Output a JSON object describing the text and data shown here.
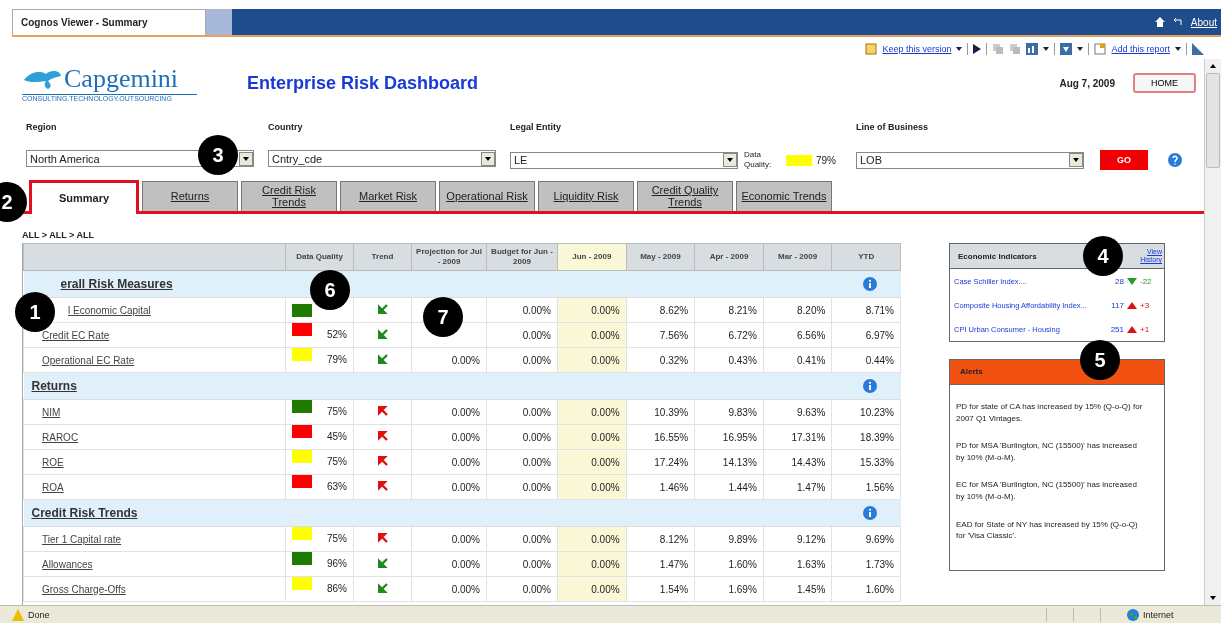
{
  "window": {
    "title": "Cognos Viewer - Summary",
    "about": "About"
  },
  "toolbar": {
    "keep": "Keep this version",
    "add": "Add this report"
  },
  "header": {
    "logo": "Capgemini",
    "tagline": "CONSULTING.TECHNOLOGY.OUTSOURCING",
    "title": "Enterprise Risk Dashboard",
    "date": "Aug 7, 2009",
    "home": "HOME"
  },
  "filters": [
    {
      "label": "Region",
      "value": "North America"
    },
    {
      "label": "Country",
      "value": "Cntry_cde"
    },
    {
      "label": "Legal Entity",
      "value": "LE"
    },
    {
      "label": "Line of Business",
      "value": "LOB"
    }
  ],
  "data_quality": {
    "label": "Data Quality:",
    "color": "#ffff00",
    "value": "79%"
  },
  "go": "GO",
  "tabs": [
    {
      "label": "Summary",
      "selected": true
    },
    {
      "label": "Returns",
      "selected": false
    },
    {
      "label": "Credit Risk Trends",
      "selected": false
    },
    {
      "label": "Market Risk",
      "selected": false
    },
    {
      "label": "Operational Risk",
      "selected": false
    },
    {
      "label": "Liquidity Risk",
      "selected": false
    },
    {
      "label": "Credit Quality Trends",
      "selected": false
    },
    {
      "label": "Economic Trends",
      "selected": false
    }
  ],
  "breadcrumb": "ALL > ALL > ALL",
  "table": {
    "columns": [
      "Data Quality",
      "Trend",
      "Projection for Jul - 2009",
      "Budget for Jun - 2009",
      "Jun - 2009",
      "May - 2009",
      "Apr - 2009",
      "Mar - 2009",
      "YTD"
    ],
    "groups": [
      {
        "title": "erall Risk Measures",
        "rows": [
          {
            "name": "l Economic Capital",
            "color": "#1e7a00",
            "improving": true,
            "values": [
              "0.00%",
              "0.00%",
              "8.62%",
              "8.21%",
              "8.20%",
              "8.71%"
            ]
          },
          {
            "name": "Credit EC Rate",
            "color": "#ff0000",
            "quality": "52%",
            "improving": true,
            "values": [
              "0.00%",
              "0.00%",
              "7.56%",
              "6.72%",
              "6.56%",
              "6.97%"
            ]
          },
          {
            "name": "Operational EC Rate",
            "color": "#ffff00",
            "quality": "79%",
            "improving": true,
            "projection": "0.00%",
            "values": [
              "0.00%",
              "0.00%",
              "0.32%",
              "0.43%",
              "0.41%",
              "0.44%"
            ]
          }
        ]
      },
      {
        "title": "Returns",
        "rows": [
          {
            "name": "NIM",
            "color": "#1e7a00",
            "quality": "75%",
            "improving": false,
            "projection": "0.00%",
            "values": [
              "0.00%",
              "0.00%",
              "10.39%",
              "9.83%",
              "9.63%",
              "10.23%"
            ]
          },
          {
            "name": "RAROC",
            "color": "#ff0000",
            "quality": "45%",
            "improving": false,
            "projection": "0.00%",
            "values": [
              "0.00%",
              "0.00%",
              "16.55%",
              "16.95%",
              "17.31%",
              "18.39%"
            ]
          },
          {
            "name": "ROE",
            "color": "#ffff00",
            "quality": "75%",
            "improving": false,
            "projection": "0.00%",
            "values": [
              "0.00%",
              "0.00%",
              "17.24%",
              "14.13%",
              "14.43%",
              "15.33%"
            ]
          },
          {
            "name": "ROA",
            "color": "#ff0000",
            "quality": "63%",
            "improving": false,
            "projection": "0.00%",
            "values": [
              "0.00%",
              "0.00%",
              "1.46%",
              "1.44%",
              "1.47%",
              "1.56%"
            ]
          }
        ]
      },
      {
        "title": "Credit Risk Trends",
        "rows": [
          {
            "name": "Tier 1 Capital rate",
            "color": "#ffff00",
            "quality": "75%",
            "improving": false,
            "projection": "0.00%",
            "values": [
              "0.00%",
              "0.00%",
              "8.12%",
              "9.89%",
              "9.12%",
              "9.69%"
            ]
          },
          {
            "name": "Allowances",
            "color": "#1e7a00",
            "quality": "96%",
            "improving": true,
            "projection": "0.00%",
            "values": [
              "0.00%",
              "0.00%",
              "1.47%",
              "1.60%",
              "1.63%",
              "1.73%"
            ]
          },
          {
            "name": "Gross Charge-Offs",
            "color": "#ffff00",
            "quality": "86%",
            "improving": true,
            "projection": "0.00%",
            "values": [
              "0.00%",
              "0.00%",
              "1.54%",
              "1.69%",
              "1.45%",
              "1.60%"
            ]
          }
        ]
      }
    ]
  },
  "indicators": {
    "title": "Economic Indicators",
    "link": "View History",
    "items": [
      {
        "name": "Case Schiller Index....",
        "value": "28",
        "rising": false,
        "change": "-22"
      },
      {
        "name": "Composite Housing Affordability Index...",
        "value": "117",
        "rising": true,
        "change": "+3"
      },
      {
        "name": "CPI Urban Consumer - Housing",
        "value": "251",
        "rising": true,
        "change": "+1"
      }
    ]
  },
  "alerts": {
    "title": "Alerts",
    "items": [
      "PD for state of CA has increased by 15% (Q-o-Q) for 2007 Q1 Vintages.",
      "PD for MSA 'Burlington, NC (15500)' has increased by 10% (M-o-M).",
      "EC for MSA 'Burlington, NC (15500)' has increased by 10% (M-o-M).",
      "EAD for State of NY has increased by 15% (Q-o-Q) for 'Visa Classic'."
    ]
  },
  "callouts": [
    "1",
    "2",
    "3",
    "4",
    "5",
    "6",
    "7"
  ],
  "status_bar": {
    "left": "Done",
    "zone": "Internet"
  }
}
